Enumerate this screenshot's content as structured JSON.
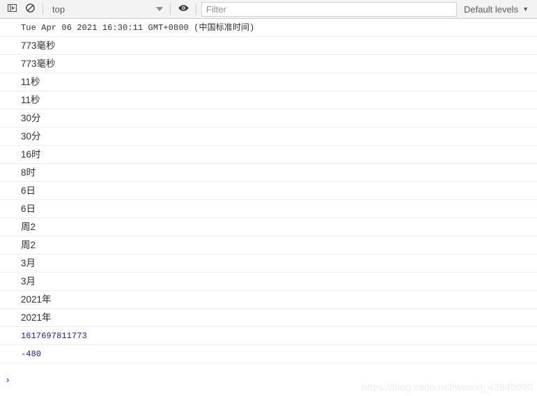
{
  "toolbar": {
    "sidebar_toggle_icon": "console-sidebar-icon",
    "clear_console_icon": "clear-console-icon",
    "context": {
      "selected": "top",
      "caret_icon": "chevron-down-icon"
    },
    "live_expression_icon": "eye-icon",
    "filter": {
      "value": "",
      "placeholder": "Filter"
    },
    "levels": {
      "label": "Default levels",
      "caret_icon": "chevron-down-icon",
      "caret_glyph": "▼"
    }
  },
  "console": {
    "messages": [
      {
        "text": "Tue Apr 06 2021 16:30:11 GMT+0800 (中国标准时间)",
        "style": "mono",
        "color": "default"
      },
      {
        "text": "773毫秒",
        "style": "sans",
        "color": "default"
      },
      {
        "text": "773毫秒",
        "style": "sans",
        "color": "default"
      },
      {
        "text": "11秒",
        "style": "sans",
        "color": "default"
      },
      {
        "text": "11秒",
        "style": "sans",
        "color": "default"
      },
      {
        "text": "30分",
        "style": "sans",
        "color": "default"
      },
      {
        "text": "30分",
        "style": "sans",
        "color": "default"
      },
      {
        "text": "16时",
        "style": "sans",
        "color": "default"
      },
      {
        "text": "8时",
        "style": "sans",
        "color": "default"
      },
      {
        "text": "6日",
        "style": "sans",
        "color": "default"
      },
      {
        "text": "6日",
        "style": "sans",
        "color": "default"
      },
      {
        "text": "周2",
        "style": "sans",
        "color": "default"
      },
      {
        "text": "周2",
        "style": "sans",
        "color": "default"
      },
      {
        "text": "3月",
        "style": "sans",
        "color": "default"
      },
      {
        "text": "3月",
        "style": "sans",
        "color": "default"
      },
      {
        "text": "2021年",
        "style": "sans",
        "color": "default"
      },
      {
        "text": "2021年",
        "style": "sans",
        "color": "default"
      },
      {
        "text": "1617697811773",
        "style": "mono",
        "color": "number"
      },
      {
        "text": "-480",
        "style": "mono",
        "color": "number"
      }
    ],
    "prompt": {
      "chevron": "›",
      "value": "",
      "placeholder": ""
    }
  },
  "watermark": {
    "text": "https://blog.csdn.net/weixin_43845090"
  },
  "colors": {
    "toolbar_bg": "#f3f3f3",
    "toolbar_border": "#cdcdcd",
    "row_separator": "#ededed",
    "text_default": "#303030",
    "text_number": "#1a1aa6",
    "prompt_chevron": "#2b6cd8",
    "watermark": "#ececec"
  }
}
